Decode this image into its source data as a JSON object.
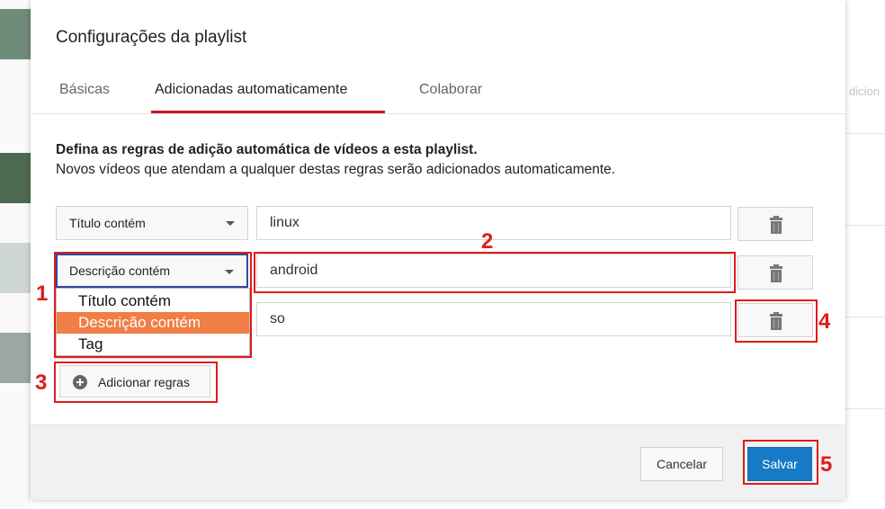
{
  "background": {
    "right_text": "dicion"
  },
  "dialog": {
    "title": "Configurações da playlist",
    "tabs": [
      {
        "label": "Básicas",
        "active": false
      },
      {
        "label": "Adicionadas automaticamente",
        "active": true
      },
      {
        "label": "Colaborar",
        "active": false
      }
    ],
    "description_bold": "Defina as regras de adição automática de vídeos a esta playlist.",
    "description": "Novos vídeos que atendam a qualquer destas regras serão adicionados automaticamente.",
    "rules": [
      {
        "condition": "Título contém",
        "value": "linux"
      },
      {
        "condition": "Descrição contém",
        "value": "android"
      },
      {
        "condition": "",
        "value": "so"
      }
    ],
    "dropdown_options": [
      {
        "label": "Título contém",
        "selected": false
      },
      {
        "label": "Descrição contém",
        "selected": true
      },
      {
        "label": "Tag",
        "selected": false
      }
    ],
    "add_rule_label": "Adicionar regras",
    "cancel_label": "Cancelar",
    "save_label": "Salvar",
    "delete_icon": "trash-icon",
    "accent_color": "#cc181e",
    "save_color": "#167ac6",
    "dropdown_highlight_color": "#f07e45"
  },
  "annotations": {
    "color": "#e01b1b",
    "labels": [
      "1",
      "2",
      "3",
      "4",
      "5"
    ]
  }
}
